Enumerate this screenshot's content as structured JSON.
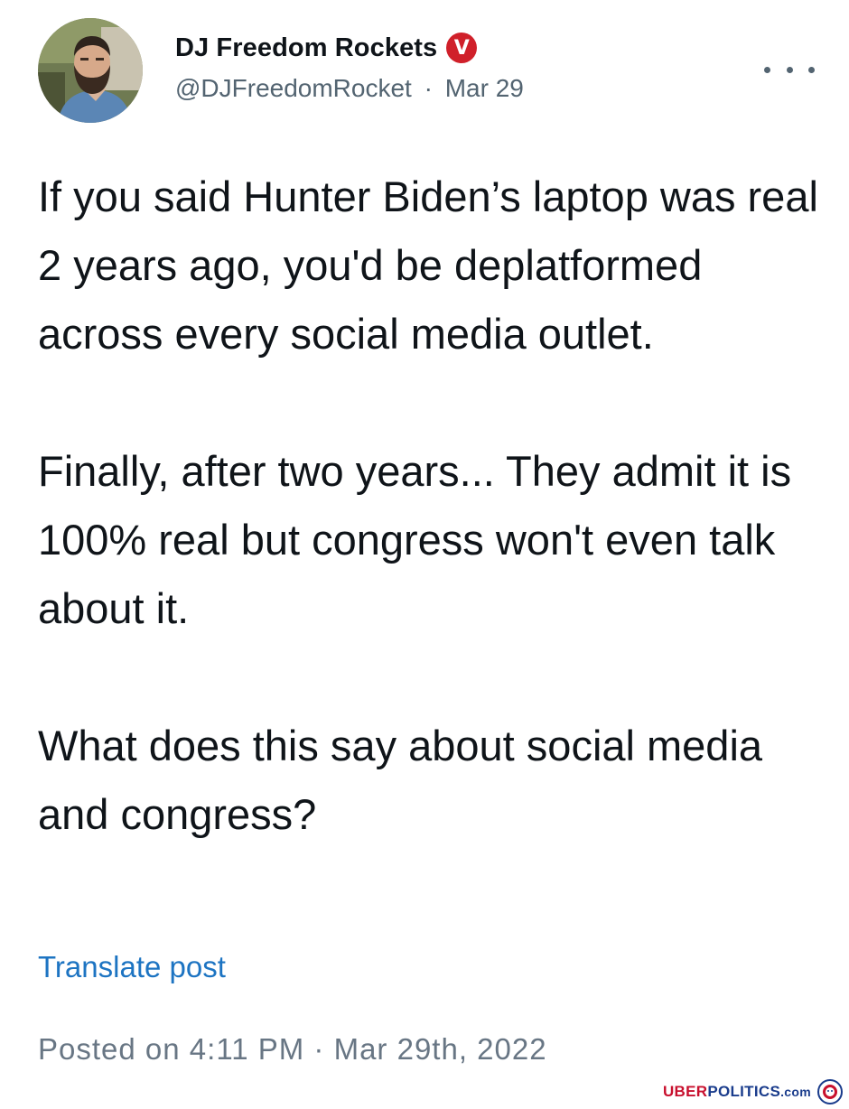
{
  "author": {
    "display_name": "DJ Freedom Rockets",
    "badge_letter": "V",
    "handle": "@DJFreedomRocket",
    "separator": "·",
    "date": "Mar 29"
  },
  "post": {
    "paragraphs": [
      "If you said Hunter Biden’s laptop was real 2 years ago, you'd be deplatformed across every social media outlet.",
      "Finally, after two years... They admit it is 100% real but congress won't even talk about it.",
      "What does this say about social media and congress?"
    ],
    "translate_label": "Translate post",
    "posted_prefix": "Posted on",
    "posted_time": "4:11 PM",
    "posted_separator": "·",
    "posted_date": "Mar 29th, 2022"
  },
  "watermark": {
    "uber": "UBER",
    "politics": "POLITICS",
    "com": ".com"
  },
  "colors": {
    "badge": "#d0202a",
    "link": "#1d74c2",
    "secondary_text": "#536471"
  },
  "icons": {
    "more": "more-horizontal-icon",
    "badge": "verified-badge-icon",
    "watermark_logo": "lion-emblem-icon"
  }
}
